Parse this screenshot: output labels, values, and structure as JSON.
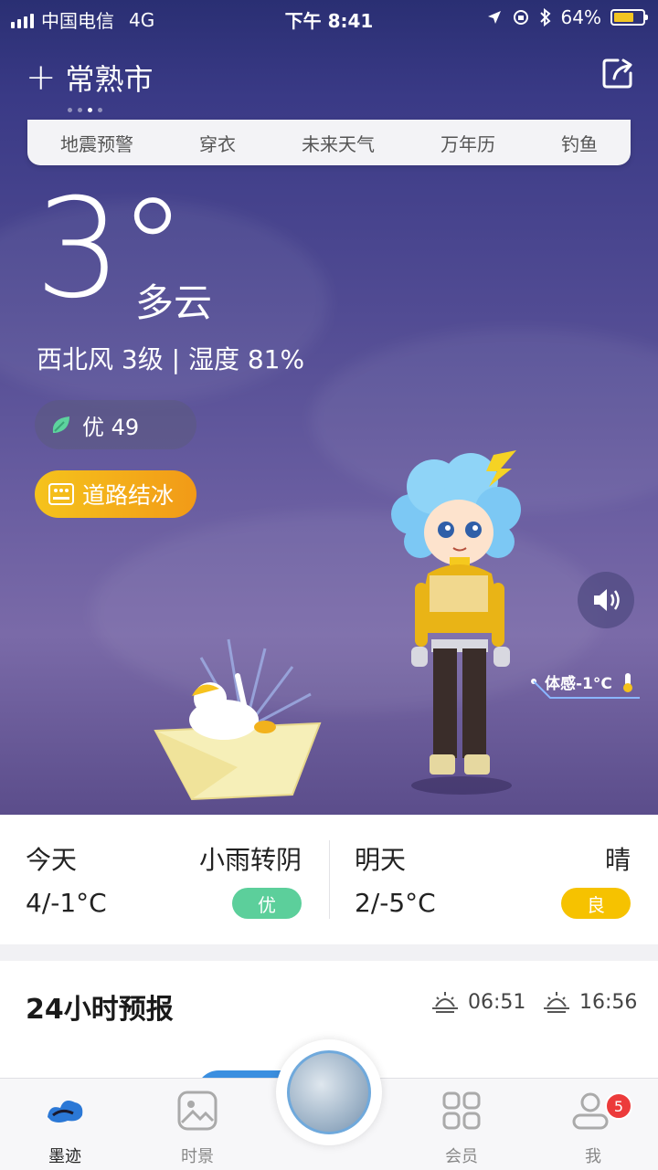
{
  "status_bar": {
    "carrier": "中国电信",
    "network": "4G",
    "time": "下午 8:41",
    "battery": "64%"
  },
  "header": {
    "city": "常熟市"
  },
  "quick_links": [
    "地震预警",
    "穿衣",
    "未来天气",
    "万年历",
    "钓鱼"
  ],
  "current": {
    "temperature": "3°",
    "condition": "多云",
    "wind_humidity": "西北风 3级 | 湿度 81%",
    "aqi_label": "优 49",
    "warning": "道路结冰",
    "feels_like": "体感-1°C"
  },
  "today": {
    "label": "今天",
    "condition": "小雨转阴",
    "range": "4/-1°C",
    "aqi": "优",
    "aqi_color": "#5ccf9b"
  },
  "tomorrow": {
    "label": "明天",
    "condition": "晴",
    "range": "2/-5°C",
    "aqi": "良",
    "aqi_color": "#f6c200"
  },
  "forecast24": {
    "title": "24小时预报",
    "sunrise": "06:51",
    "sunset": "16:56"
  },
  "nav": {
    "items": [
      "墨迹",
      "时景",
      "会员",
      "我"
    ],
    "badge": "5"
  },
  "colors": {
    "accent_blue": "#2f7ed8",
    "warn_orange": "#f29a17"
  }
}
